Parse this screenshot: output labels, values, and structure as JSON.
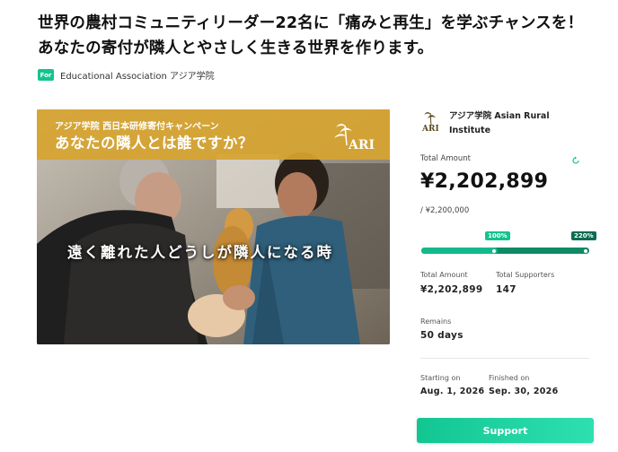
{
  "project": {
    "title": "世界の農村コミュニティリーダー22名に「痛みと再生」を学ぶチャンスを！あなたの寄付が隣人とやさしく生きる世界を作ります。"
  },
  "organization": {
    "badge": "For",
    "name": "Educational Association アジア学院"
  },
  "hero": {
    "banner_subtitle": "アジア学院 西日本研修寄付キャンペーン",
    "banner_title": "あなたの隣人とは誰ですか？",
    "logo_text": "ARI",
    "caption": "遠く離れた人どうしが隣人になる時"
  },
  "institute": {
    "name": "アジア学院 Asian Rural Institute",
    "logo_text": "ARI"
  },
  "funding": {
    "total_label": "Total Amount",
    "total_amount": "¥2,202,899",
    "goal": "/ ¥2,200,000",
    "progress_first_label": "100%",
    "progress_second_label": "220%",
    "progress_first_fraction": 1.0,
    "progress_second_fraction": 2.2,
    "stats": [
      {
        "label": "Total Amount",
        "value": "¥2,202,899"
      },
      {
        "label": "Total Supporters",
        "value": "147"
      }
    ],
    "remains_label": "Remains",
    "remains_value": "50 days",
    "start_label": "Starting on",
    "start_value": "Aug. 1, 2026",
    "end_label": "Finished on",
    "end_value": "Sep. 30, 2026"
  },
  "actions": {
    "support_label": "Support"
  },
  "icons": {
    "refresh": "refresh-icon",
    "org_badge": "for-badge-icon"
  },
  "colors": {
    "accent": "#14c38e",
    "accent_dark": "#0f8a66",
    "banner": "#d6a430"
  }
}
